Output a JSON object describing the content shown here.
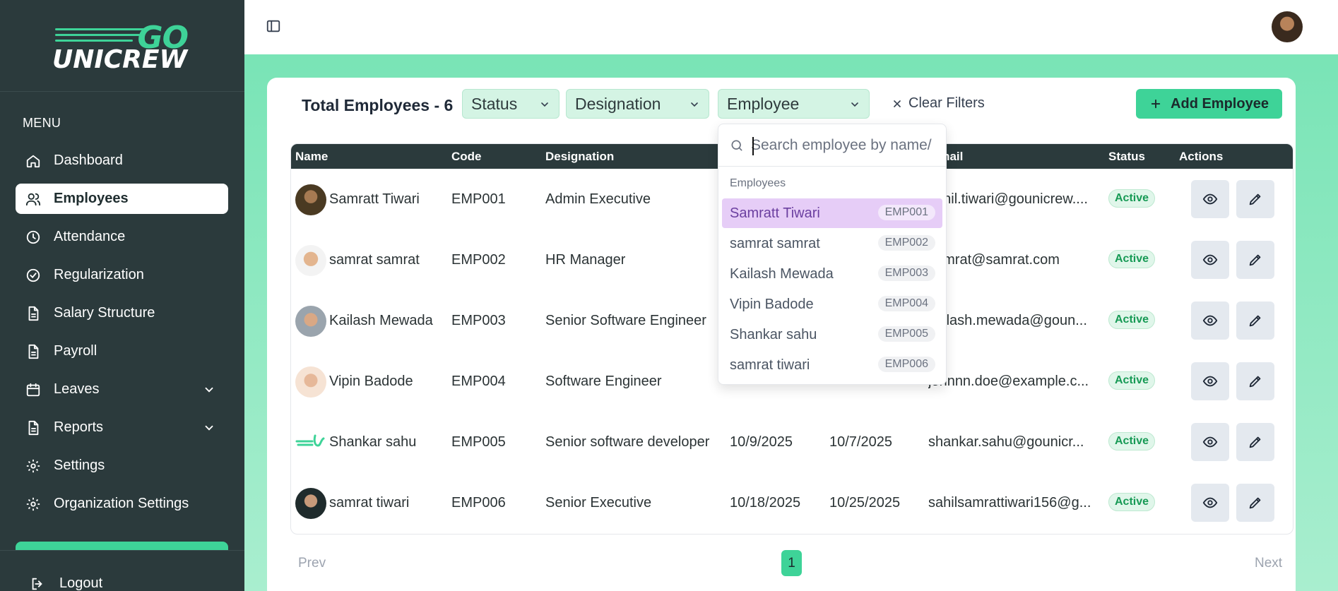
{
  "brand": {
    "logo_top": "GO",
    "logo_bottom": "UNICREW"
  },
  "sidebar": {
    "menu_heading": "MENU",
    "items": [
      {
        "label": "Dashboard",
        "icon": "home-icon"
      },
      {
        "label": "Employees",
        "icon": "users-icon",
        "active": true
      },
      {
        "label": "Attendance",
        "icon": "clock-icon"
      },
      {
        "label": "Regularization",
        "icon": "check-circle-icon"
      },
      {
        "label": "Salary Structure",
        "icon": "document-icon"
      },
      {
        "label": "Payroll",
        "icon": "document-icon"
      },
      {
        "label": "Leaves",
        "icon": "calendar-icon",
        "expandable": true
      },
      {
        "label": "Reports",
        "icon": "document-icon",
        "expandable": true
      },
      {
        "label": "Settings",
        "icon": "gear-icon"
      },
      {
        "label": "Organization Settings",
        "icon": "gear-icon"
      }
    ],
    "logout_label": "Logout"
  },
  "toolbar": {
    "total_label": "Total Employees - 6",
    "filters": {
      "status": "Status",
      "designation": "Designation",
      "employee": "Employee"
    },
    "clear_filters": "Clear Filters",
    "add_employee": "Add Employee"
  },
  "table": {
    "headers": {
      "name": "Name",
      "code": "Code",
      "designation": "Designation",
      "email": "Email",
      "status": "Status",
      "actions": "Actions"
    },
    "rows": [
      {
        "name": "Samratt Tiwari",
        "code": "EMP001",
        "designation": "Admin Executive",
        "date1": "",
        "date2": "",
        "email": "sahil.tiwari@gounicrew....",
        "status": "Active"
      },
      {
        "name": "samrat samrat",
        "code": "EMP002",
        "designation": "HR Manager",
        "date1": "",
        "date2": "",
        "email": "samrat@samrat.com",
        "status": "Active"
      },
      {
        "name": "Kailash Mewada",
        "code": "EMP003",
        "designation": "Senior Software Engineer",
        "date1": "",
        "date2": "",
        "email": "kailash.mewada@goun...",
        "status": "Active"
      },
      {
        "name": "Vipin Badode",
        "code": "EMP004",
        "designation": "Software Engineer",
        "date1": "",
        "date2": "",
        "email": "johnnn.doe@example.c...",
        "status": "Active"
      },
      {
        "name": "Shankar sahu",
        "code": "EMP005",
        "designation": "Senior software developer",
        "date1": "10/9/2025",
        "date2": "10/7/2025",
        "email": "shankar.sahu@gounicr...",
        "status": "Active"
      },
      {
        "name": "samrat tiwari",
        "code": "EMP006",
        "designation": "Senior Executive",
        "date1": "10/18/2025",
        "date2": "10/25/2025",
        "email": "sahilsamrattiwari156@g...",
        "status": "Active"
      }
    ]
  },
  "pagination": {
    "prev": "Prev",
    "current": "1",
    "next": "Next"
  },
  "employee_dropdown": {
    "search_placeholder": "Search employee by name/",
    "heading": "Employees",
    "options": [
      {
        "name": "Samratt Tiwari",
        "code": "EMP001",
        "selected": true
      },
      {
        "name": "samrat samrat",
        "code": "EMP002"
      },
      {
        "name": "Kailash Mewada",
        "code": "EMP003"
      },
      {
        "name": "Vipin Badode",
        "code": "EMP004"
      },
      {
        "name": "Shankar sahu",
        "code": "EMP005"
      },
      {
        "name": "samrat tiwari",
        "code": "EMP006"
      }
    ]
  },
  "colors": {
    "sidebar": "#2b3a3c",
    "accent": "#3ed398",
    "selected_option": "#e6cdf7",
    "status_active": "#179a55"
  }
}
